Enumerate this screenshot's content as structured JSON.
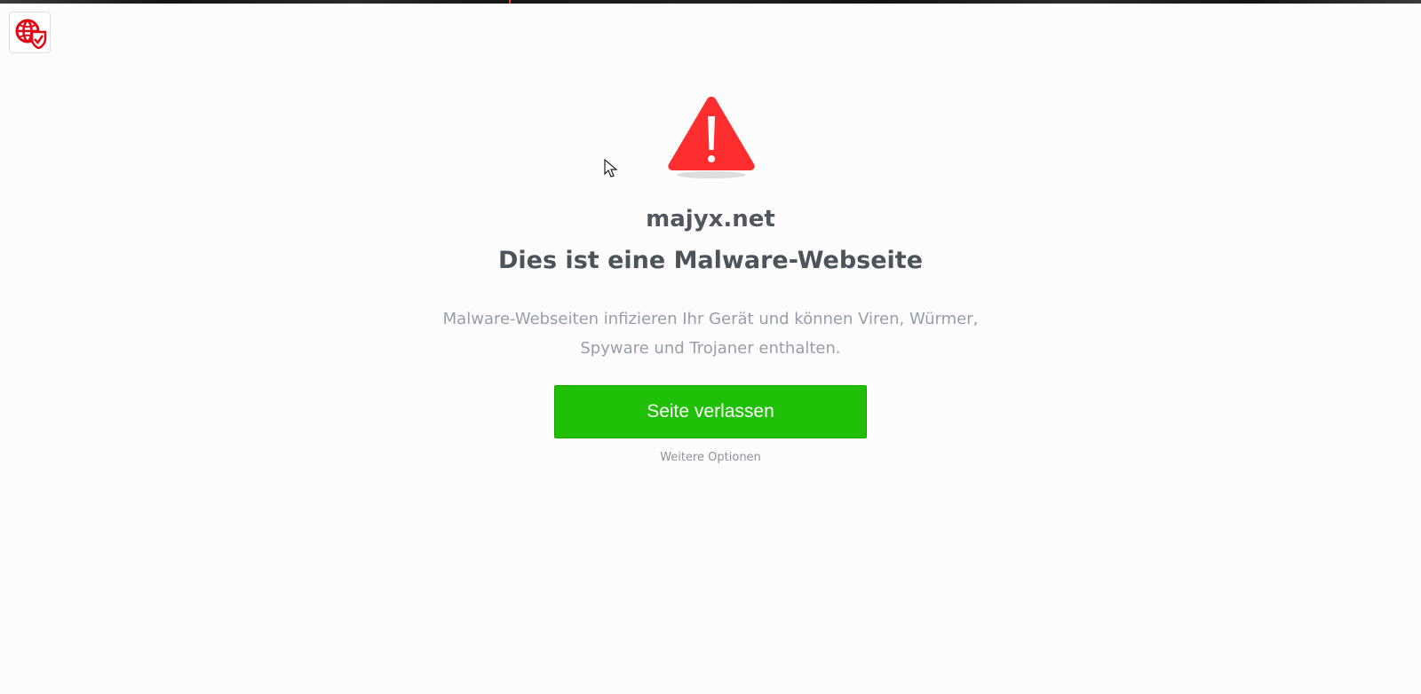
{
  "page": {
    "background": "#fcfcfc"
  },
  "brand": {
    "icon": "globe-shield-icon",
    "color": "#e30613"
  },
  "warning": {
    "icon": "warning-triangle-icon",
    "color": "#ff2e2e"
  },
  "site": {
    "name": "majyx.net"
  },
  "alert": {
    "title": "Dies ist eine Malware-Webseite",
    "description_line1": "Malware-Webseiten infizieren Ihr Gerät und können Viren, Würmer,",
    "description_line2": "Spyware und Trojaner enthalten."
  },
  "actions": {
    "leave_label": "Seite verlassen",
    "more_options_label": "Weitere Optionen",
    "leave_color": "#20bf08"
  }
}
